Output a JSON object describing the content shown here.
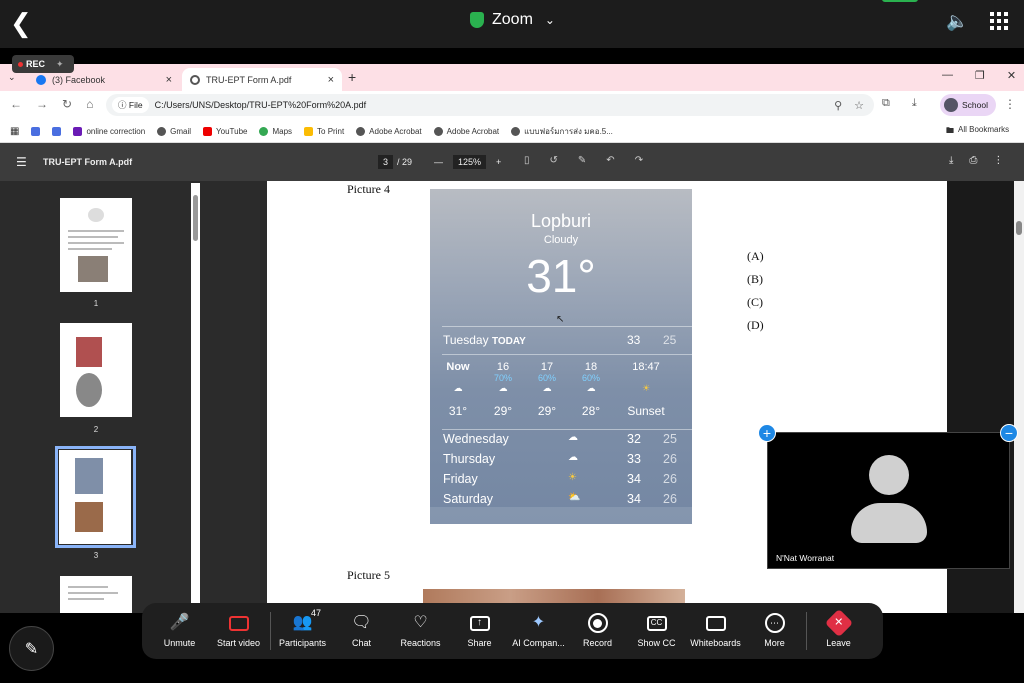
{
  "zoom": {
    "title": "Zoom",
    "rec_label": "REC",
    "participants_count": "47"
  },
  "browser": {
    "tabs": [
      {
        "label": "(3) Facebook"
      },
      {
        "label": "TRU-EPT Form A.pdf"
      }
    ],
    "address": {
      "chip": "File",
      "url": "C:/Users/UNS/Desktop/TRU-EPT%20Form%20A.pdf"
    },
    "profile": "School",
    "bookmarks": [
      "online correction",
      "Gmail",
      "YouTube",
      "Maps",
      "To Print",
      "Adobe Acrobat",
      "Adobe Acrobat",
      "แบบฟอร์มการส่ง มคอ.5..."
    ],
    "all_bookmarks": "All Bookmarks"
  },
  "pdf": {
    "filename": "TRU-EPT Form A.pdf",
    "current_page": "3",
    "total_pages": "/ 29",
    "zoom": "125%",
    "thumb_labels": [
      "1",
      "2",
      "3"
    ],
    "picture4": "Picture 4",
    "picture5": "Picture 5",
    "options": [
      "(A)",
      "(B)",
      "(C)",
      "(D)"
    ]
  },
  "weather": {
    "city": "Lopburi",
    "condition": "Cloudy",
    "temp": "31°",
    "today": {
      "day": "Tuesday",
      "tag": "TODAY",
      "hi": "33",
      "lo": "25"
    },
    "hourly": [
      {
        "time": "Now",
        "pct": "",
        "temp": "31°"
      },
      {
        "time": "16",
        "pct": "70%",
        "temp": "29°"
      },
      {
        "time": "17",
        "pct": "60%",
        "temp": "29°"
      },
      {
        "time": "18",
        "pct": "60%",
        "temp": "28°"
      },
      {
        "time": "18:47",
        "pct": "",
        "temp": "Sunset"
      }
    ],
    "days": [
      {
        "day": "Wednesday",
        "hi": "32",
        "lo": "25"
      },
      {
        "day": "Thursday",
        "hi": "33",
        "lo": "26"
      },
      {
        "day": "Friday",
        "hi": "34",
        "lo": "26"
      },
      {
        "day": "Saturday",
        "hi": "34",
        "lo": "26"
      }
    ]
  },
  "video": {
    "name": "N'Nat Worranat"
  },
  "controls": [
    {
      "label": "Unmute"
    },
    {
      "label": "Start video"
    },
    {
      "label": "Participants"
    },
    {
      "label": "Chat"
    },
    {
      "label": "Reactions"
    },
    {
      "label": "Share"
    },
    {
      "label": "AI Compan..."
    },
    {
      "label": "Record"
    },
    {
      "label": "Show CC"
    },
    {
      "label": "Whiteboards"
    },
    {
      "label": "More"
    },
    {
      "label": "Leave"
    }
  ],
  "colors": {
    "accent_green": "#2ab14f",
    "leave_red": "#e02f44",
    "video_badge_blue": "#1e88e5"
  }
}
